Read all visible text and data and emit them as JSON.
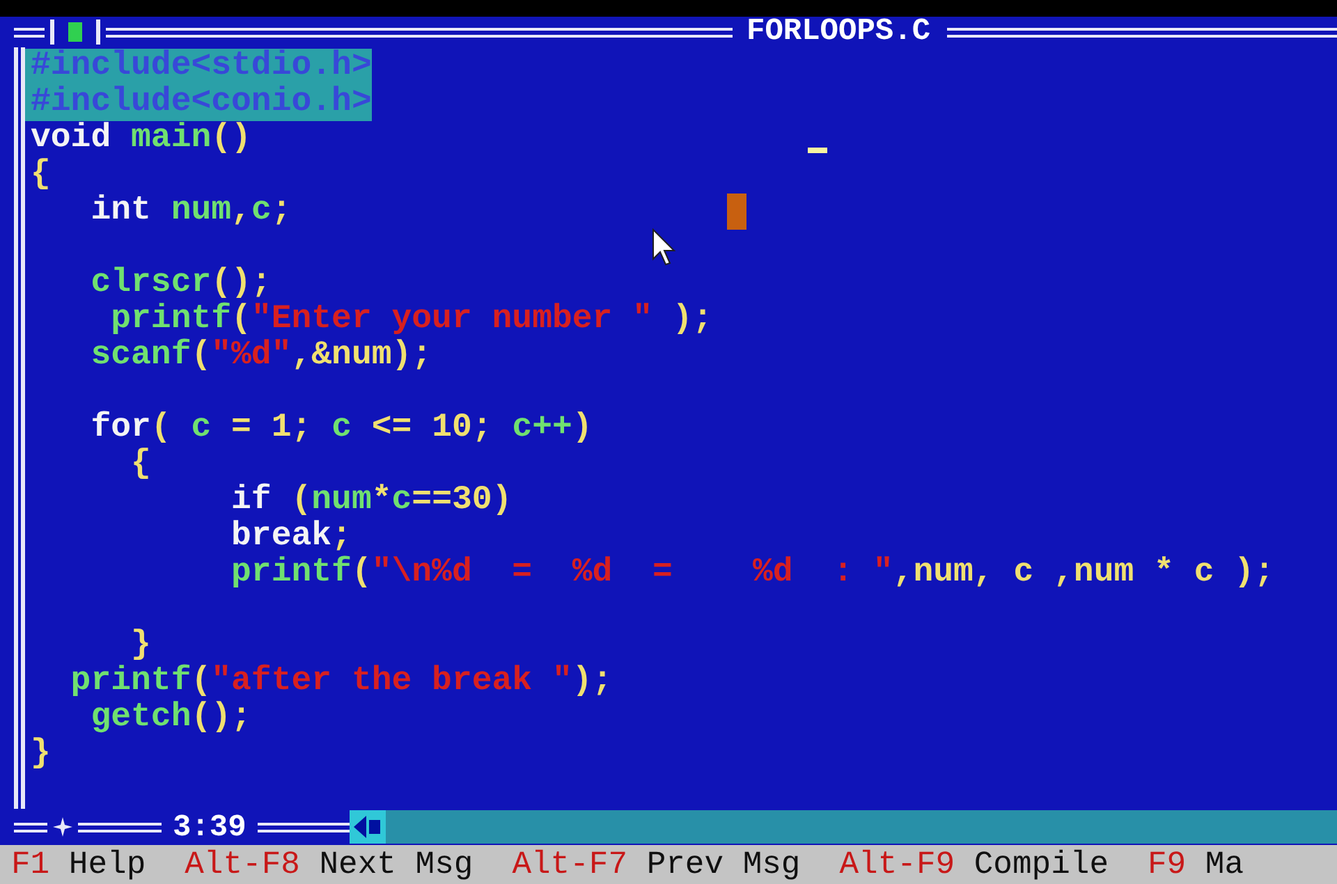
{
  "window": {
    "title": "FORLOOPS.C"
  },
  "editor": {
    "lines": [
      {
        "kind": "code",
        "selected": true,
        "tokens": [
          {
            "kind": "directive",
            "text": "#include<stdio.h>"
          }
        ]
      },
      {
        "kind": "code",
        "selected": true,
        "tokens": [
          {
            "kind": "directive",
            "text": "#include<conio.h>"
          }
        ]
      },
      {
        "kind": "code",
        "selected": false,
        "tokens": [
          {
            "kind": "keyword",
            "text": "void "
          },
          {
            "kind": "ident",
            "text": "main"
          },
          {
            "kind": "punct",
            "text": "()"
          }
        ]
      },
      {
        "kind": "code",
        "selected": false,
        "tokens": [
          {
            "kind": "punct",
            "text": "{"
          }
        ]
      },
      {
        "kind": "code",
        "selected": false,
        "tokens": [
          {
            "kind": "keyword",
            "text": "   int"
          },
          {
            "kind": "ident",
            "text": " num"
          },
          {
            "kind": "punct",
            "text": ","
          },
          {
            "kind": "ident",
            "text": "c"
          },
          {
            "kind": "punct",
            "text": ";"
          }
        ]
      },
      {
        "kind": "blank"
      },
      {
        "kind": "code",
        "selected": false,
        "tokens": [
          {
            "kind": "ident",
            "text": "   clrscr"
          },
          {
            "kind": "punct",
            "text": "();"
          }
        ]
      },
      {
        "kind": "code",
        "selected": false,
        "tokens": [
          {
            "kind": "ident",
            "text": "    printf"
          },
          {
            "kind": "punct",
            "text": "("
          },
          {
            "kind": "string",
            "text": "\"Enter your number \""
          },
          {
            "kind": "punct",
            "text": " );"
          }
        ]
      },
      {
        "kind": "code",
        "selected": false,
        "tokens": [
          {
            "kind": "ident",
            "text": "   scanf"
          },
          {
            "kind": "punct",
            "text": "("
          },
          {
            "kind": "string",
            "text": "\"%d\""
          },
          {
            "kind": "punct",
            "text": ",&num);"
          }
        ]
      },
      {
        "kind": "blank"
      },
      {
        "kind": "code",
        "selected": false,
        "tokens": [
          {
            "kind": "keyword",
            "text": "   for"
          },
          {
            "kind": "punct",
            "text": "( "
          },
          {
            "kind": "ident",
            "text": "c"
          },
          {
            "kind": "punct",
            "text": " = "
          },
          {
            "kind": "number",
            "text": "1"
          },
          {
            "kind": "punct",
            "text": "; "
          },
          {
            "kind": "ident",
            "text": "c"
          },
          {
            "kind": "punct",
            "text": " <= "
          },
          {
            "kind": "number",
            "text": "10"
          },
          {
            "kind": "punct",
            "text": "; "
          },
          {
            "kind": "ident",
            "text": "c++"
          },
          {
            "kind": "punct",
            "text": ")"
          }
        ]
      },
      {
        "kind": "code",
        "selected": false,
        "tokens": [
          {
            "kind": "punct",
            "text": "     {"
          }
        ]
      },
      {
        "kind": "code",
        "selected": false,
        "tokens": [
          {
            "kind": "keyword",
            "text": "          if"
          },
          {
            "kind": "punct",
            "text": " ("
          },
          {
            "kind": "ident",
            "text": "num"
          },
          {
            "kind": "punct",
            "text": "*"
          },
          {
            "kind": "ident",
            "text": "c"
          },
          {
            "kind": "number",
            "text": "==30)"
          }
        ]
      },
      {
        "kind": "code",
        "selected": false,
        "tokens": [
          {
            "kind": "keyword",
            "text": "          break"
          },
          {
            "kind": "punct",
            "text": ";"
          }
        ]
      },
      {
        "kind": "code",
        "selected": false,
        "tokens": [
          {
            "kind": "ident",
            "text": "          printf"
          },
          {
            "kind": "punct",
            "text": "("
          },
          {
            "kind": "string",
            "text": "\"\\n%d  =  %d  =    %d  : \""
          },
          {
            "kind": "punct",
            "text": ",num, c ,num * c );"
          }
        ]
      },
      {
        "kind": "blank"
      },
      {
        "kind": "code",
        "selected": false,
        "tokens": [
          {
            "kind": "punct",
            "text": "     }"
          }
        ]
      },
      {
        "kind": "code",
        "selected": false,
        "tokens": [
          {
            "kind": "ident",
            "text": "  printf"
          },
          {
            "kind": "punct",
            "text": "("
          },
          {
            "kind": "string",
            "text": "\"after the break \""
          },
          {
            "kind": "punct",
            "text": ");"
          }
        ]
      },
      {
        "kind": "code",
        "selected": false,
        "tokens": [
          {
            "kind": "ident",
            "text": "   getch"
          },
          {
            "kind": "punct",
            "text": "();"
          }
        ]
      },
      {
        "kind": "code",
        "selected": false,
        "tokens": [
          {
            "kind": "punct",
            "text": "}"
          }
        ]
      }
    ]
  },
  "position": "3:39",
  "status_bar": [
    {
      "key": "F1",
      "label": "Help"
    },
    {
      "key": "Alt-F8",
      "label": "Next Msg"
    },
    {
      "key": "Alt-F7",
      "label": "Prev Msg"
    },
    {
      "key": "Alt-F9",
      "label": "Compile"
    },
    {
      "key": "F9",
      "label": "Ma"
    }
  ]
}
